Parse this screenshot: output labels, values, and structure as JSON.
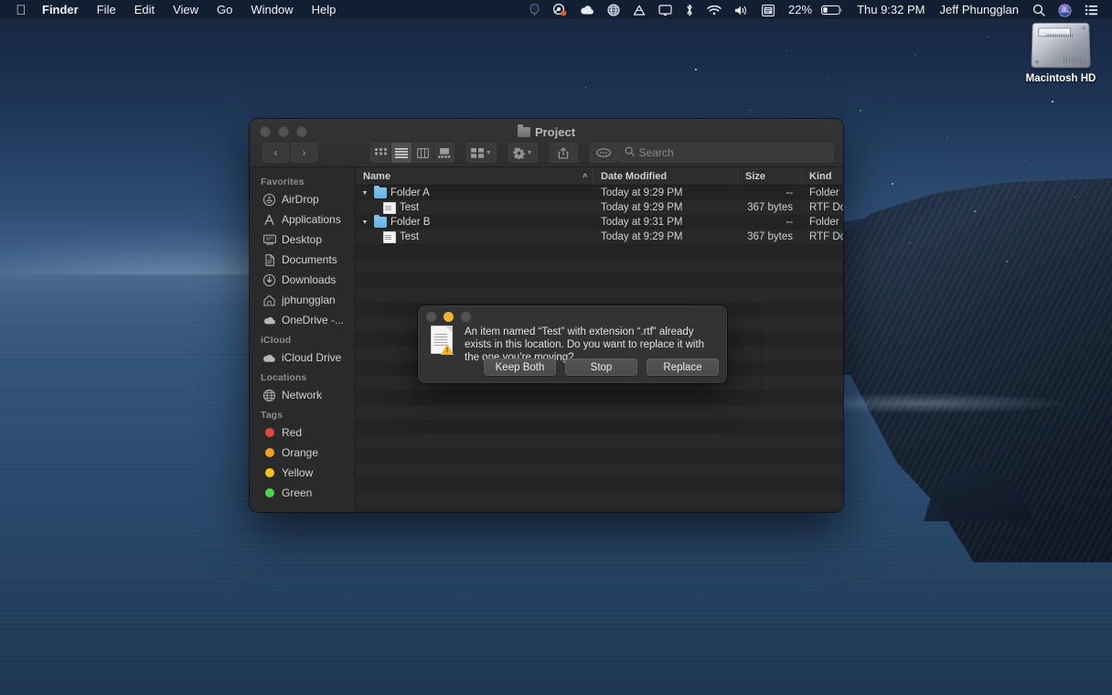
{
  "menubar": {
    "apple_icon": "apple-logo",
    "items": [
      {
        "label": "Finder",
        "bold": true
      },
      {
        "label": "File"
      },
      {
        "label": "Edit"
      },
      {
        "label": "View"
      },
      {
        "label": "Go"
      },
      {
        "label": "Window"
      },
      {
        "label": "Help"
      }
    ],
    "status_icons": [
      "balloon-icon",
      "steam-icon",
      "onedrive-cloud-icon",
      "globe-icon",
      "google-drive-icon",
      "airplay-display-icon",
      "bluetooth-icon",
      "wifi-icon",
      "volume-icon",
      "input-menu-icon"
    ],
    "battery_percent": "22%",
    "battery_icon": "battery-icon",
    "clock": "Thu 9:32 PM",
    "user_name": "Jeff Phungglan",
    "spotlight_icon": "search-icon",
    "siri_icon": "siri-icon",
    "control_center_icon": "control-center-icon"
  },
  "desktop": {
    "hard_drive": {
      "label": "Macintosh HD",
      "icon": "hard-drive-icon"
    }
  },
  "finder": {
    "title": "Project",
    "title_icon": "folder-icon",
    "traffic_lights": [
      "close",
      "minimize",
      "zoom"
    ],
    "toolbar": {
      "back_label": "‹",
      "forward_label": "›",
      "view_modes": [
        {
          "name": "icon-view",
          "selected": false
        },
        {
          "name": "list-view",
          "selected": true
        },
        {
          "name": "column-view",
          "selected": false
        },
        {
          "name": "gallery-view",
          "selected": false
        }
      ],
      "group_by_label": "group-by-icon",
      "action_label": "gear-icon",
      "share_label": "share-icon",
      "tags_label": "tags-icon"
    },
    "search": {
      "placeholder": "Search",
      "value": "",
      "icon": "search-icon"
    },
    "sidebar": {
      "sections": [
        {
          "heading": "Favorites",
          "items": [
            {
              "label": "AirDrop",
              "icon": "airdrop-icon"
            },
            {
              "label": "Applications",
              "icon": "applications-icon"
            },
            {
              "label": "Desktop",
              "icon": "desktop-icon"
            },
            {
              "label": "Documents",
              "icon": "documents-icon"
            },
            {
              "label": "Downloads",
              "icon": "downloads-icon"
            },
            {
              "label": "jphungglan",
              "icon": "home-icon"
            },
            {
              "label": "OneDrive -...",
              "icon": "cloud-icon"
            }
          ]
        },
        {
          "heading": "iCloud",
          "items": [
            {
              "label": "iCloud Drive",
              "icon": "icloud-icon"
            }
          ]
        },
        {
          "heading": "Locations",
          "items": [
            {
              "label": "Network",
              "icon": "network-globe-icon"
            }
          ]
        },
        {
          "heading": "Tags",
          "items": [
            {
              "label": "Red",
              "icon": "tag-dot",
              "color": "#e0483c"
            },
            {
              "label": "Orange",
              "icon": "tag-dot",
              "color": "#f0a020"
            },
            {
              "label": "Yellow",
              "icon": "tag-dot",
              "color": "#f3c220"
            },
            {
              "label": "Green",
              "icon": "tag-dot",
              "color": "#4cd44c"
            }
          ]
        }
      ]
    },
    "columns": [
      {
        "label": "Name",
        "sort_indicator": "˄"
      },
      {
        "label": "Date Modified"
      },
      {
        "label": "Size"
      },
      {
        "label": "Kind"
      }
    ],
    "rows": [
      {
        "name": "Folder A",
        "date": "Today at 9:29 PM",
        "size": "--",
        "kind": "Folder",
        "type": "folder",
        "level": 0,
        "expanded": true
      },
      {
        "name": "Test",
        "date": "Today at 9:29 PM",
        "size": "367 bytes",
        "kind": "RTF Doc",
        "type": "doc",
        "level": 1
      },
      {
        "name": "Folder B",
        "date": "Today at 9:31 PM",
        "size": "--",
        "kind": "Folder",
        "type": "folder",
        "level": 0,
        "expanded": true
      },
      {
        "name": "Test",
        "date": "Today at 9:29 PM",
        "size": "367 bytes",
        "kind": "RTF Doc",
        "type": "doc",
        "level": 1
      }
    ]
  },
  "dialog": {
    "message": "An item named “Test” with extension “.rtf” already exists in this location. Do you want to replace it with the one you’re moving?",
    "icon": "document-warning-icon",
    "buttons": [
      {
        "label": "Keep Both",
        "name": "keep-both-button"
      },
      {
        "label": "Stop",
        "name": "stop-button"
      },
      {
        "label": "Replace",
        "name": "replace-button"
      }
    ]
  },
  "colors": {
    "accent_folder": "#5fb2e4",
    "warning": "#f5b32a",
    "window_bg": "#282828",
    "sidebar_bg": "#2a2a2a",
    "list_bg": "#232323"
  }
}
